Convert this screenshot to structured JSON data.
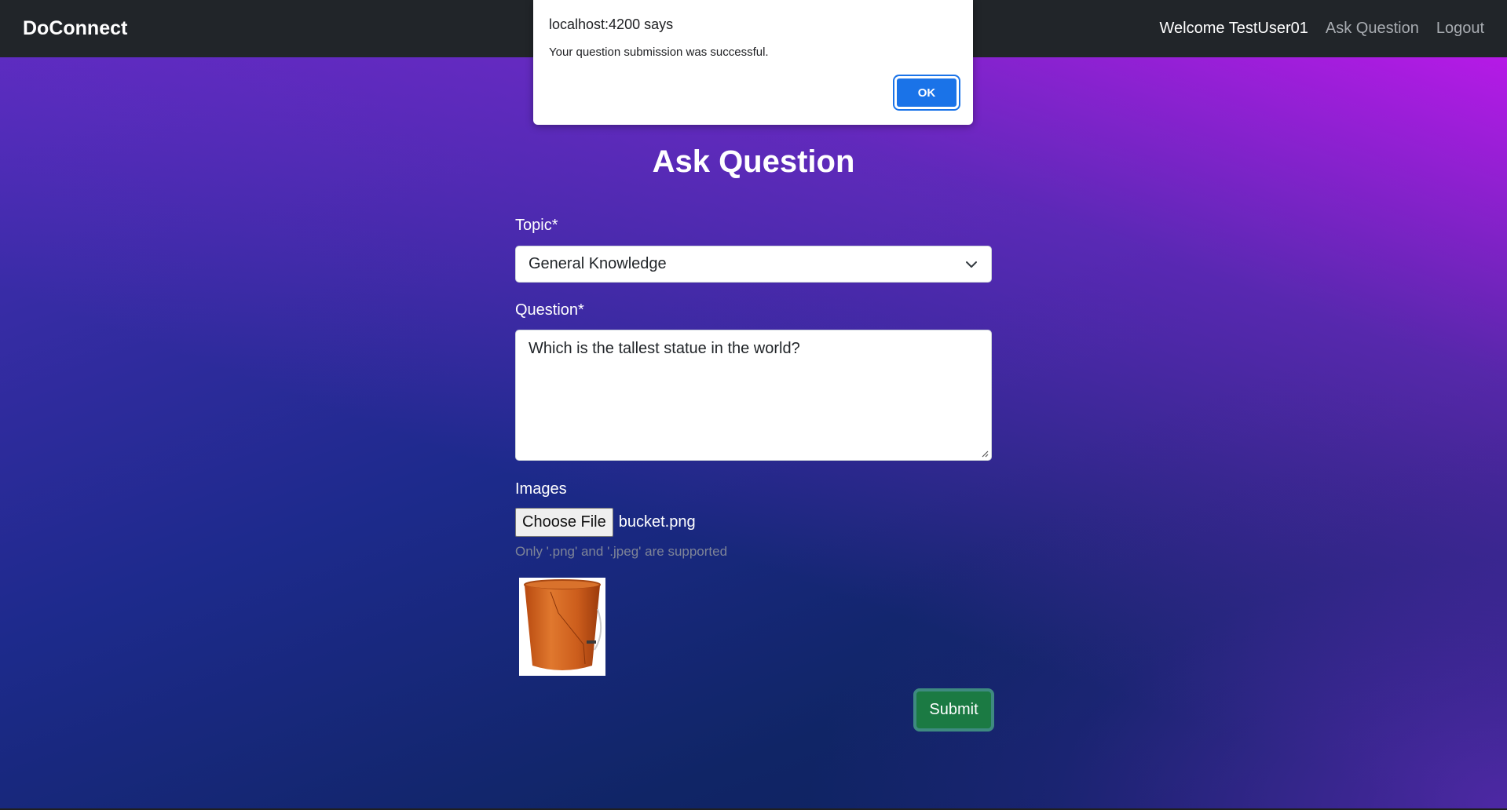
{
  "navbar": {
    "brand": "DoConnect",
    "welcome": "Welcome TestUser01",
    "ask_question": "Ask Question",
    "logout": "Logout"
  },
  "form": {
    "title": "Ask Question",
    "topic_label": "Topic*",
    "topic_value": "General Knowledge",
    "question_label": "Question*",
    "question_value": "Which is the tallest statue in the world?",
    "images_label": "Images",
    "choose_file": "Choose File",
    "file_name": "bucket.png",
    "hint": "Only '.png' and '.jpeg' are supported",
    "submit": "Submit"
  },
  "dialog": {
    "title": "localhost:4200 says",
    "message": "Your question submission was successful.",
    "ok": "OK"
  },
  "colors": {
    "navbar": "#212529",
    "submit": "#1b7a43",
    "dialog_button": "#1a73e8"
  }
}
